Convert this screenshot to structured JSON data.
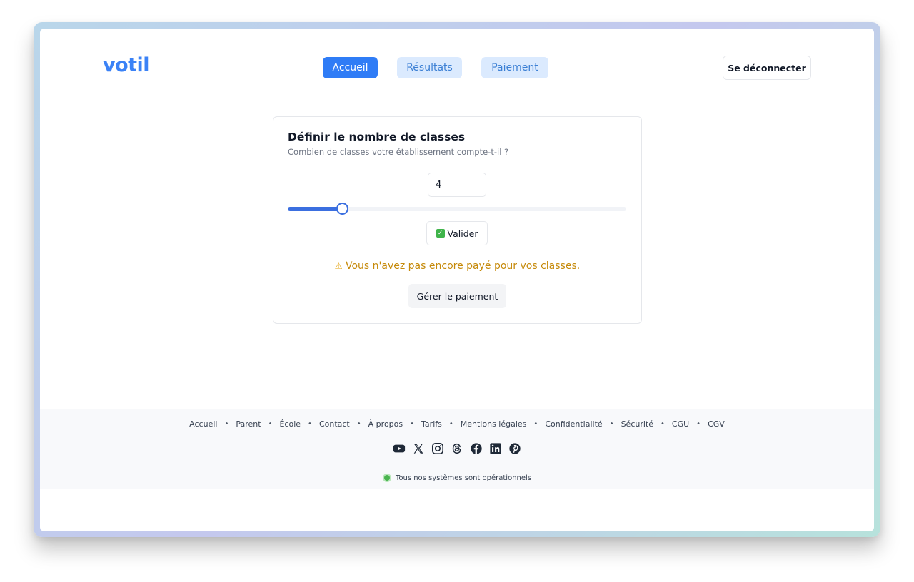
{
  "brand": {
    "logo": "votil"
  },
  "nav": {
    "items": [
      {
        "label": "Accueil",
        "active": true
      },
      {
        "label": "Résultats",
        "active": false
      },
      {
        "label": "Paiement",
        "active": false
      }
    ],
    "logout_label": "Se déconnecter"
  },
  "card": {
    "title": "Définir le nombre de classes",
    "subtitle": "Combien de classes votre établissement compte-t-il ?",
    "count_value": "4",
    "slider_fraction": 0.16,
    "validate_label": "Valider",
    "warning_text": "Vous n'avez pas encore payé pour vos classes.",
    "pay_label": "Gérer le paiement"
  },
  "footer": {
    "links": [
      "Accueil",
      "Parent",
      "École",
      "Contact",
      "À propos",
      "Tarifs",
      "Mentions légales",
      "Confidentialité",
      "Sécurité",
      "CGU",
      "CGV"
    ],
    "socials": [
      "youtube-icon",
      "x-icon",
      "instagram-icon",
      "threads-icon",
      "facebook-icon",
      "linkedin-icon",
      "pinterest-icon"
    ],
    "status_text": "Tous nos systèmes sont opérationnels"
  },
  "colors": {
    "accent": "#2f7cf6",
    "warning": "#c68a0a",
    "status_ok": "#4ab44f"
  }
}
